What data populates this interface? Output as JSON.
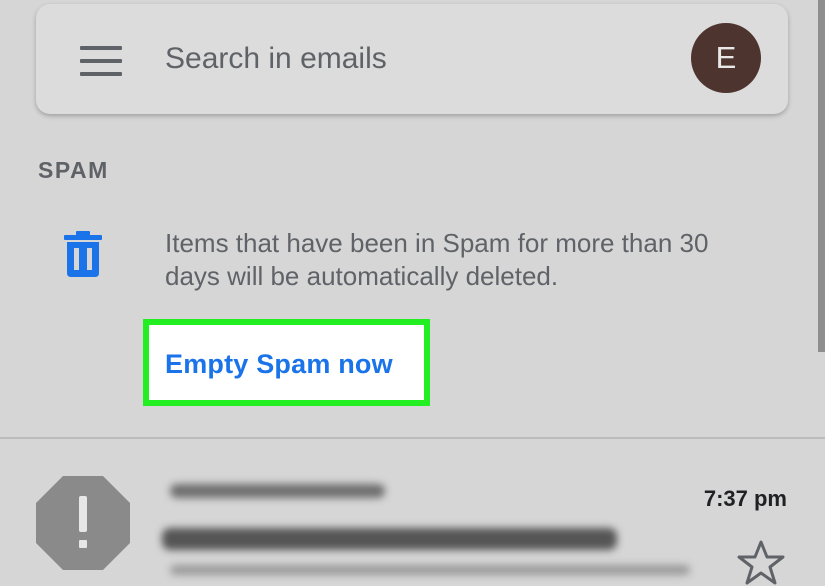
{
  "search": {
    "placeholder": "Search in emails"
  },
  "account": {
    "avatar_letter": "E",
    "avatar_color": "#4e342e"
  },
  "section": {
    "label": "SPAM"
  },
  "banner": {
    "icon": "trash-icon",
    "message": "Items that have been in Spam for more than 30 days will be automatically deleted.",
    "action_label": "Empty Spam now",
    "action_color": "#1a73e8",
    "highlight_color": "#22ee22"
  },
  "emails": [
    {
      "time": "7:37 pm",
      "avatar_icon": "exclamation-icon",
      "starred": false
    }
  ],
  "colors": {
    "background": "#d6d6d6",
    "text_secondary": "#5f6368",
    "icon_blue": "#1a73e8"
  }
}
